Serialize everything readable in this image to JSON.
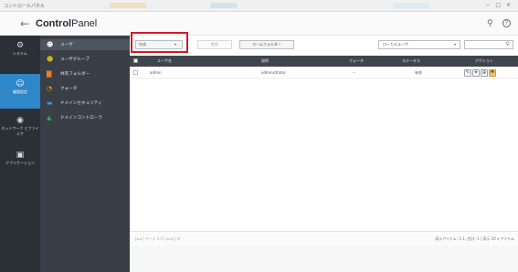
{
  "window": {
    "title": "コントロールパネル",
    "controls": [
      "−",
      "□",
      "×"
    ]
  },
  "header": {
    "back_icon": "←",
    "app_name_prefix": "Control",
    "app_name_suffix": "Panel",
    "search_icon": "⚲",
    "help_icon": "?"
  },
  "rail": {
    "items": [
      {
        "icon": "gear-icon",
        "glyph": "⚙",
        "label": "システム"
      },
      {
        "icon": "user-icon",
        "glyph": "👤",
        "label": "権限設定",
        "active": true
      },
      {
        "icon": "network-icon",
        "glyph": "◉",
        "label": "ネットワーク とファイルサ"
      },
      {
        "icon": "app-icon",
        "glyph": "▣",
        "label": "アプリケーション"
      }
    ]
  },
  "subnav": {
    "items": [
      {
        "icon": "user-icon",
        "glyph": "👤",
        "color": "#ffffff",
        "label": "ユーザ",
        "active": true
      },
      {
        "icon": "user-group-icon",
        "glyph": "👥",
        "color": "#f1c40f",
        "label": "ユーザグループ"
      },
      {
        "icon": "shared-folder-icon",
        "glyph": "▇",
        "color": "#e67e22",
        "label": "共有フォルダー"
      },
      {
        "icon": "quota-icon",
        "glyph": "◔",
        "color": "#f39c12",
        "label": "クォータ"
      },
      {
        "icon": "domain-security-icon",
        "glyph": "▬",
        "color": "#3498db",
        "label": "ドメインセキュリティ"
      },
      {
        "icon": "domain-controller-icon",
        "glyph": "▲",
        "color": "#27ae60",
        "label": "ドメインコントローラ"
      }
    ]
  },
  "toolbar": {
    "create_label": "作成",
    "create_caret": "▾",
    "delete_label": "削除",
    "home_folder_label": "ホームフォルダー",
    "user_type_select": "ローカルユーザ",
    "select_caret": "▾",
    "search_placeholder": "",
    "search_icon": "⚲"
  },
  "table": {
    "columns": [
      "ユーザ名",
      "説明",
      "クォータ",
      "ステータス",
      "アクション"
    ],
    "rows": [
      {
        "username": "admin",
        "description": "administrator",
        "quota": "--",
        "status": "有効"
      }
    ],
    "action_icons": [
      "edit-icon",
      "group-icon",
      "permission-icon",
      "warn-icon"
    ],
    "action_glyphs": [
      "✎",
      "✦",
      "⊕",
      "⚑"
    ]
  },
  "pager": {
    "left": "|◂  ◂  |  ページ 1  /1  |  ▸  ▸|  |  ⟳",
    "right_prefix": "表示アイテム: 1-1, 合計: 1  |  表示",
    "per_page": "10",
    "right_suffix": "▾ アイテム"
  }
}
